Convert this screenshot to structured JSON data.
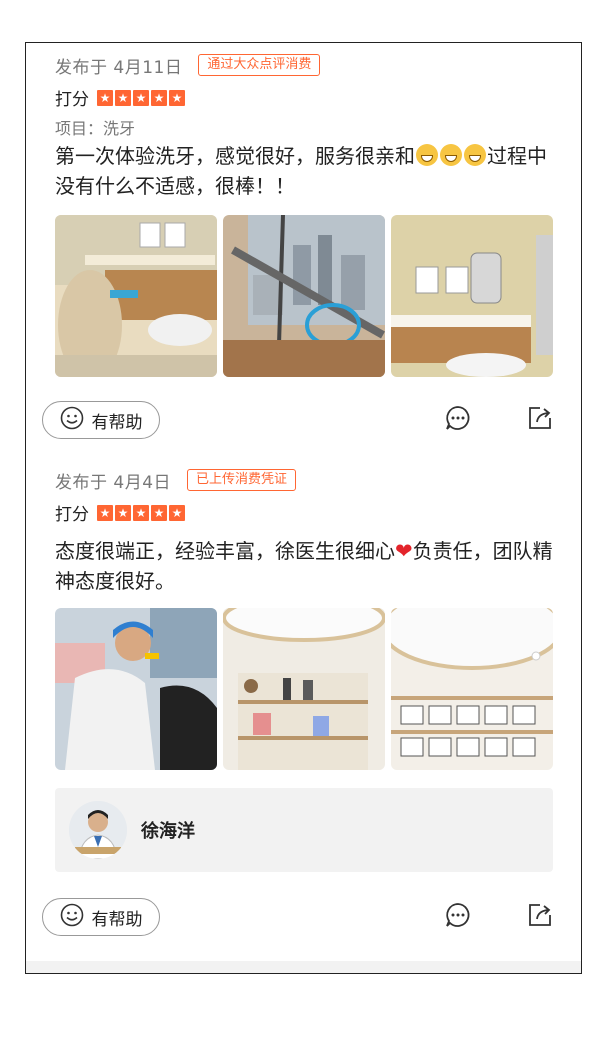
{
  "reviews": [
    {
      "date": "发布于 4月11日",
      "badge": "通过大众点评消费",
      "score_label": "打分",
      "rating": 5,
      "project": "项目：洗牙",
      "text_part1": "第一次体验洗牙，感觉很好，服务很亲和",
      "text_part2": "过程中没有什么不适感，很棒！！",
      "photos": [
        "dental-chair-photo",
        "window-view-photo",
        "cabinet-mirror-photo"
      ],
      "helpful_label": "有帮助"
    },
    {
      "date": "发布于 4月4日",
      "badge": "已上传消费凭证",
      "score_label": "打分",
      "rating": 5,
      "text_part1": "态度很端正，经验丰富，徐医生很细心",
      "text_part2": "负责任，团队精神态度很好。",
      "photos": [
        "dentist-treating-photo",
        "display-shelf-photo",
        "certificate-wall-photo"
      ],
      "doctor": {
        "name": "徐海洋"
      },
      "helpful_label": "有帮助"
    }
  ],
  "colors": {
    "accent": "#ff6633",
    "text": "#222222",
    "muted": "#777777",
    "card_bg": "#f2f2f2"
  },
  "icons": [
    "smiley-icon",
    "comment-icon",
    "share-icon",
    "star-icon",
    "heart-emoji",
    "grin-emoji"
  ]
}
